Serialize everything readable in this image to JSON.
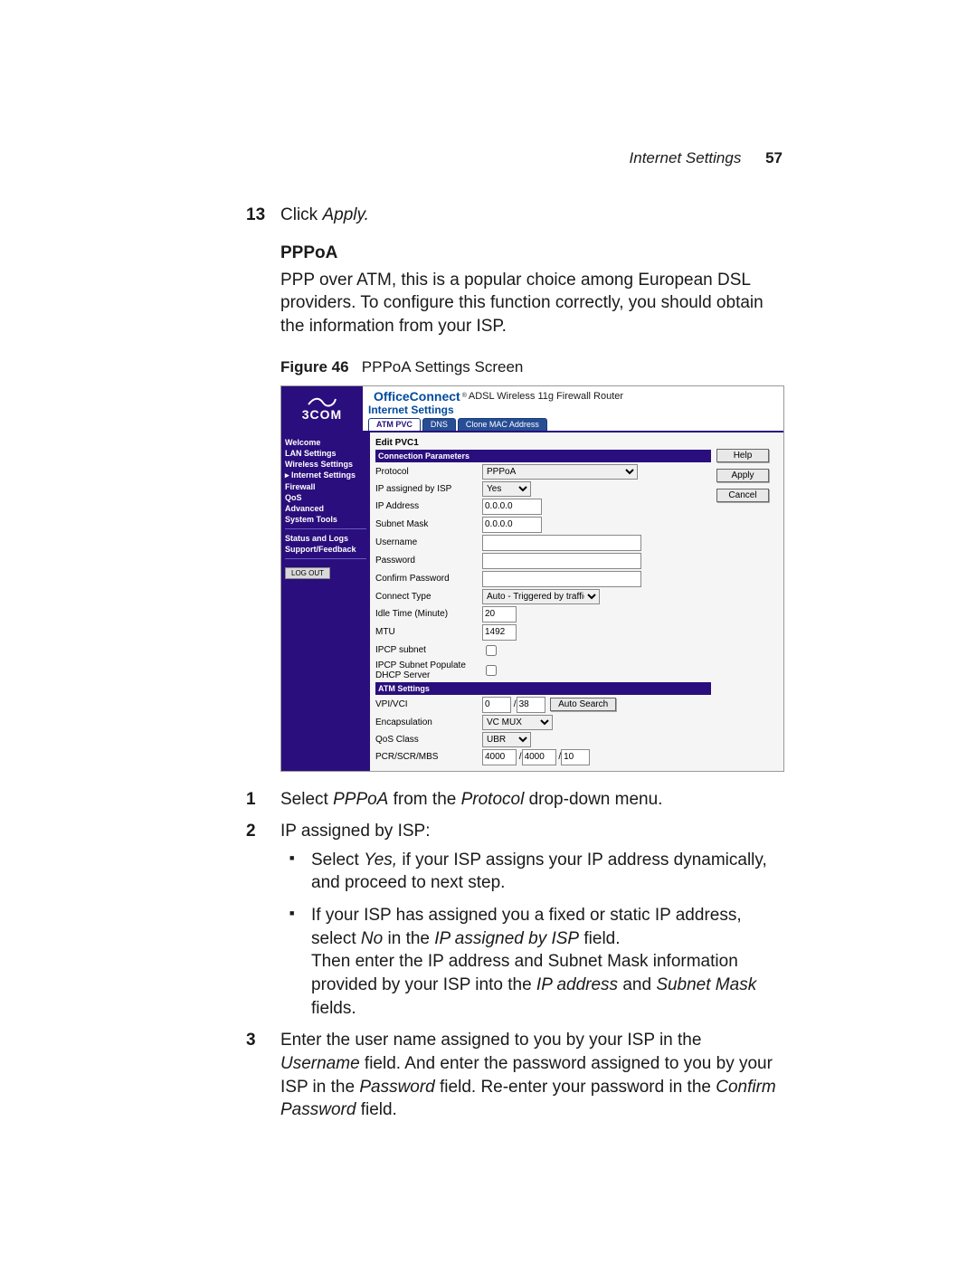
{
  "header": {
    "section_name": "Internet Settings",
    "page_number": "57"
  },
  "step13": {
    "number": "13",
    "text_a": "Click ",
    "text_b": "Apply.",
    "full": "Click Apply."
  },
  "pppoa_heading": "PPPoA",
  "pppoa_intro": "PPP over ATM, this is a popular choice among European DSL providers. To configure this function correctly, you should obtain the information from your ISP.",
  "figure": {
    "label": "Figure 46",
    "caption": "PPPoA Settings Screen"
  },
  "embedded": {
    "brand_prefix": "OfficeConnect",
    "brand_suffix": "ADSL Wireless 11g Firewall Router",
    "logo": "3COM",
    "subtitle": "Internet Settings",
    "tabs": [
      "ATM PVC",
      "DNS",
      "Clone MAC Address"
    ],
    "sidebar": {
      "items": [
        "Welcome",
        "LAN Settings",
        "Wireless Settings",
        "Internet Settings",
        "Firewall",
        "QoS",
        "Advanced",
        "System Tools"
      ],
      "lower": [
        "Status and Logs",
        "Support/Feedback"
      ],
      "logout": "LOG OUT"
    },
    "panel_title": "Edit PVC1",
    "section1": "Connection Parameters",
    "section2": "ATM Settings",
    "labels": {
      "protocol": "Protocol",
      "ip_isp": "IP assigned by ISP",
      "ip_addr": "IP Address",
      "mask": "Subnet Mask",
      "user": "Username",
      "pass": "Password",
      "cpass": "Confirm Password",
      "conn": "Connect Type",
      "idle": "Idle Time (Minute)",
      "mtu": "MTU",
      "ipcp": "IPCP subnet",
      "ipcp2": "IPCP Subnet Populate DHCP Server",
      "vpivci": "VPI/VCI",
      "encap": "Encapsulation",
      "qos": "QoS Class",
      "pcr": "PCR/SCR/MBS"
    },
    "values": {
      "protocol": "PPPoA",
      "ip_isp": "Yes",
      "ip_addr": "0.0.0.0",
      "mask": "0.0.0.0",
      "conn": "Auto - Triggered by traffic",
      "idle": "20",
      "mtu": "1492",
      "vpi": "0",
      "vci": "38",
      "encap": "VC MUX",
      "qos": "UBR",
      "pcr": "4000",
      "scr": "4000",
      "mbs": "10"
    },
    "buttons": {
      "help": "Help",
      "apply": "Apply",
      "cancel": "Cancel",
      "autosearch": "Auto Search"
    }
  },
  "steps": {
    "s1n": "1",
    "s1a": "Select ",
    "s1b": "PPPoA",
    "s1c": " from the ",
    "s1d": "Protocol",
    "s1e": " drop-down menu.",
    "s2n": "2",
    "s2": "IP assigned by ISP:",
    "b1a": "Select ",
    "b1b": "Yes,",
    "b1c": " if your ISP assigns your IP address dynamically, and proceed to next step.",
    "b2a": "If your ISP has assigned you a fixed or static IP address, select ",
    "b2b": "No",
    "b2c": " in the ",
    "b2d": "IP assigned by ISP",
    "b2e": " field.",
    "b2f": "Then enter the IP address and Subnet Mask information provided by your ISP into the ",
    "b2g": "IP address",
    "b2h": " and ",
    "b2i": "Subnet Mask",
    "b2j": " fields.",
    "s3n": "3",
    "s3a": "Enter the user name assigned to you by your ISP in the ",
    "s3b": "Username",
    "s3c": " field. And enter the password assigned to you by your ISP in the ",
    "s3d": "Password",
    "s3e": " field. Re-enter your password in the ",
    "s3f": "Confirm Password",
    "s3g": " field."
  }
}
